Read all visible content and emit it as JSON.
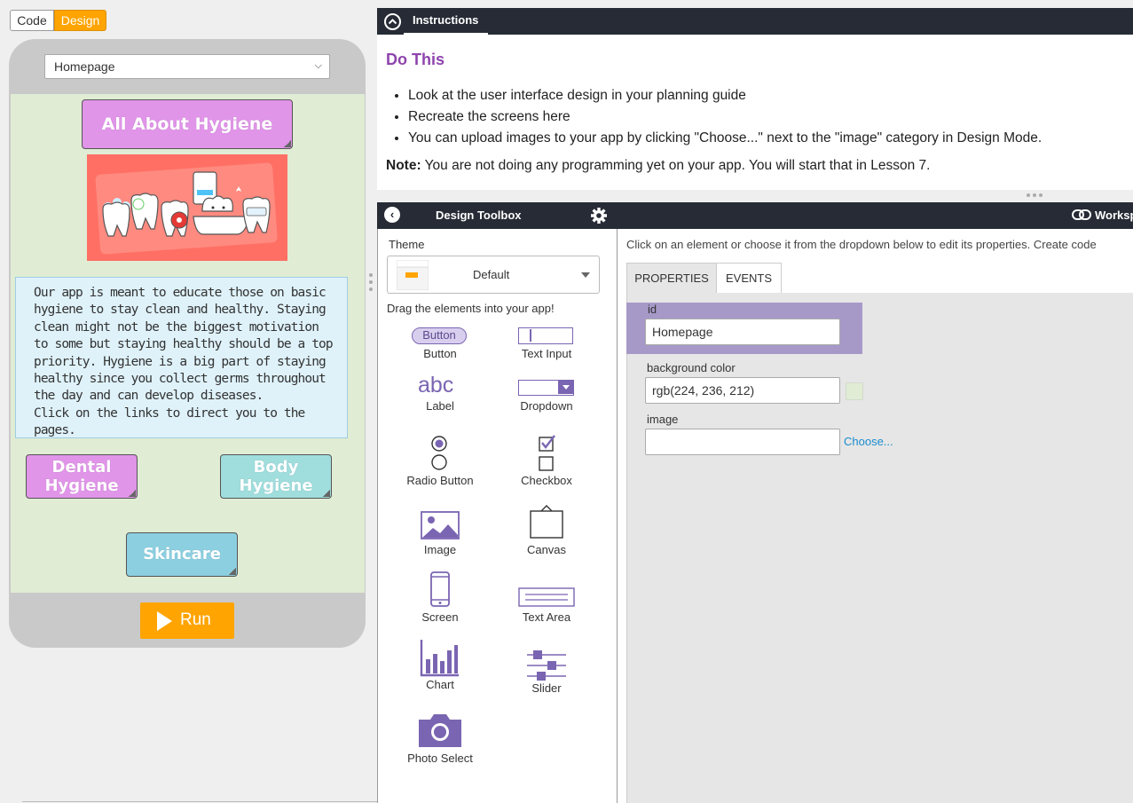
{
  "mode_toggle": {
    "code_label": "Code",
    "design_label": "Design"
  },
  "app_preview": {
    "screen_dropdown_value": "Homepage",
    "hygiene_button": "All About Hygiene",
    "description_lines": [
      "Our app is meant to educate those on basic",
      "hygiene to stay clean and healthy. Staying",
      "clean might not be the biggest motivation",
      "to some but staying healthy should be a top",
      "priority. Hygiene is a big part of staying",
      "healthy since you collect germs throughout",
      "the day and can develop diseases.",
      "Click on the links to direct you to the pages."
    ],
    "dental_button": [
      "Dental",
      "Hygiene"
    ],
    "body_button": [
      "Body",
      "Hygiene"
    ],
    "skincare_button": "Skincare",
    "run_label": "Run"
  },
  "instructions": {
    "tab_label": "Instructions",
    "heading": "Do This",
    "items": [
      "Look at the user interface design in your planning guide",
      "Recreate the screens here",
      "You can upload images to your app by clicking \"Choose...\" next to the \"image\" category in Design Mode."
    ],
    "note_label": "Note:",
    "note_text": " You are not doing any programming yet on your app. You will start that in Lesson 7."
  },
  "toolbox": {
    "title": "Design Toolbox",
    "theme_label": "Theme",
    "theme_value": "Default",
    "drag_label": "Drag the elements into your app!",
    "button_icon_label": "Button",
    "tools": [
      {
        "name": "Button",
        "icon": "button-icon"
      },
      {
        "name": "Text Input",
        "icon": "text-input-icon"
      },
      {
        "name": "Label",
        "icon": "label-icon",
        "icon_text": "abc"
      },
      {
        "name": "Dropdown",
        "icon": "dropdown-icon"
      },
      {
        "name": "Radio Button",
        "icon": "radio-button-icon"
      },
      {
        "name": "Checkbox",
        "icon": "checkbox-icon"
      },
      {
        "name": "Image",
        "icon": "image-icon"
      },
      {
        "name": "Canvas",
        "icon": "canvas-icon"
      },
      {
        "name": "Screen",
        "icon": "screen-icon"
      },
      {
        "name": "Text Area",
        "icon": "text-area-icon"
      },
      {
        "name": "Chart",
        "icon": "chart-icon"
      },
      {
        "name": "Slider",
        "icon": "slider-icon"
      },
      {
        "name": "Photo Select",
        "icon": "photo-select-icon"
      }
    ]
  },
  "workspace": {
    "title": "Workspace",
    "help_text": "Click on an element or choose it from the dropdown below to edit its properties. Create code",
    "tabs": [
      "PROPERTIES",
      "EVENTS"
    ],
    "properties": {
      "id_label": "id",
      "id_value": "Homepage",
      "bg_label": "background color",
      "bg_value": "rgb(224, 236, 212)",
      "image_label": "image",
      "image_value": "",
      "choose_label": "Choose..."
    }
  },
  "colors": {
    "accent_orange": "#ffa400",
    "header_dark": "#262b35",
    "purple": "#8e44ad",
    "screen_bg": "#e0ecd4"
  }
}
